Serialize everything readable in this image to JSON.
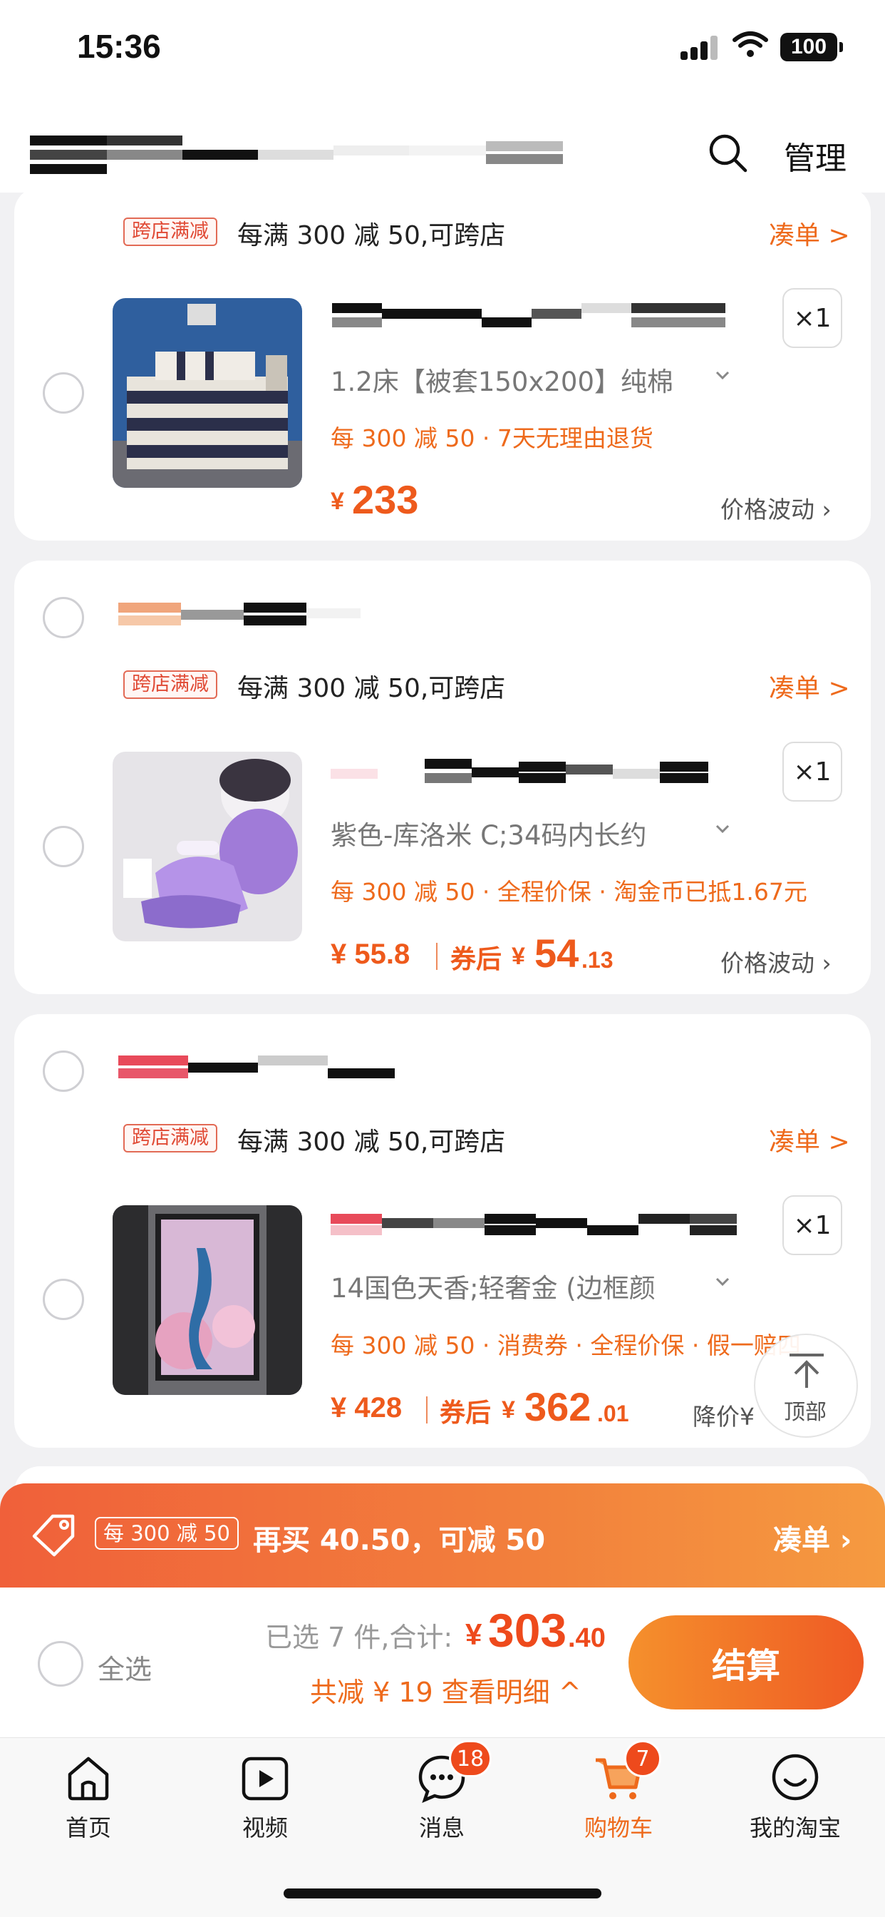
{
  "status_bar": {
    "time": "15:36",
    "battery": "100"
  },
  "header": {
    "manage_label": "管理"
  },
  "cards": [
    {
      "promo_tag": "跨店满减",
      "promo_text": "每满 300 减 50,可跨店",
      "collect": "凑单 >",
      "item": {
        "quantity": "×1",
        "spec": "1.2床【被套150x200】纯棉",
        "benefits": "每 300 减 50 · 7天无理由退货",
        "price_symbol": "¥",
        "price": "233",
        "price_fluct": "价格波动 ›"
      }
    },
    {
      "promo_tag": "跨店满减",
      "promo_text": "每满 300 减 50,可跨店",
      "collect": "凑单 >",
      "item": {
        "quantity": "×1",
        "spec": "紫色-库洛米 C;34码内长约",
        "benefits": "每 300 减 50 · 全程价保 · 淘金币已抵1.67元",
        "price": "¥ 55.8",
        "coupon_label": "券后",
        "after_price_symbol": "¥",
        "after_price_int": "54",
        "after_price_dec": ".13",
        "price_fluct": "价格波动 ›"
      }
    },
    {
      "promo_tag": "跨店满减",
      "promo_text": "每满 300 减 50,可跨店",
      "collect": "凑单 >",
      "item": {
        "quantity": "×1",
        "spec": "14国色天香;轻奢金 (边框颜",
        "benefits": "每 300 减 50 · 消费券 · 全程价保 · 假一赔四",
        "price": "¥ 428",
        "coupon_label": "券后",
        "after_price_symbol": "¥",
        "after_price_int": "362",
        "after_price_dec": ".01",
        "price_fluct": "降价¥"
      }
    }
  ],
  "back_to_top": {
    "label": "顶部"
  },
  "promo_banner": {
    "tag": "每 300 减 50",
    "text": "再买 40.50，可减 50",
    "collect": "凑单 ›"
  },
  "action_bar": {
    "select_all": "全选",
    "summary": "已选 7 件,合计:",
    "total_symbol": "¥",
    "total_int": "303",
    "total_dec": ".40",
    "discount": "共减 ¥ 19  查看明细 ^",
    "checkout": "结算"
  },
  "tabbar": {
    "items": [
      {
        "label": "首页",
        "icon": "home-icon"
      },
      {
        "label": "视频",
        "icon": "video-icon"
      },
      {
        "label": "消息",
        "icon": "message-icon",
        "badge": "18"
      },
      {
        "label": "购物车",
        "icon": "cart-icon",
        "badge": "7",
        "active": true
      },
      {
        "label": "我的淘宝",
        "icon": "profile-icon"
      }
    ]
  },
  "colors": {
    "accent": "#ee6a1c",
    "price": "#ee5a1c",
    "banner_start": "#f0603a",
    "banner_end": "#f59a40"
  }
}
